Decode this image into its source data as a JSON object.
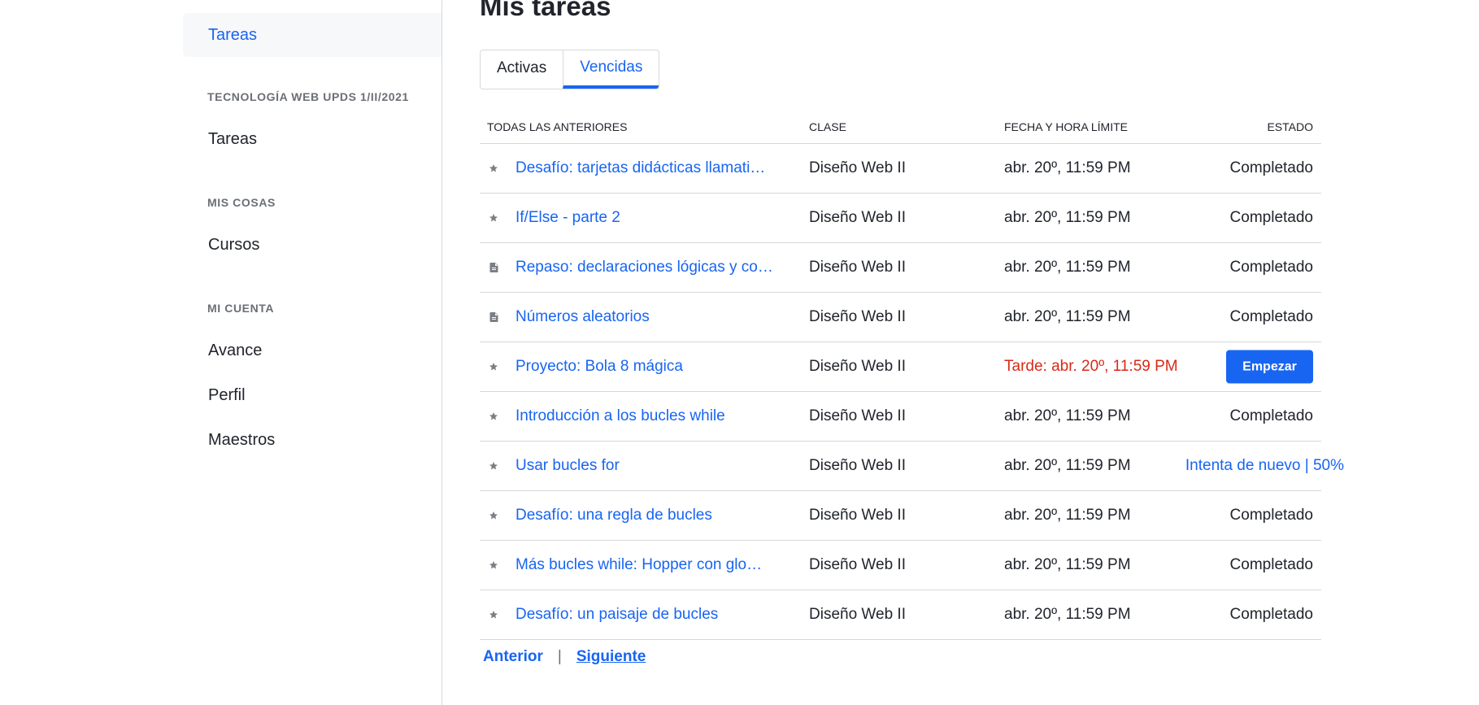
{
  "sidebar": {
    "active_item": "Tareas",
    "sections": [
      {
        "heading": "TECNOLOGÍA WEB UPDS 1/II/2021",
        "items": [
          "Tareas"
        ]
      },
      {
        "heading": "MIS COSAS",
        "items": [
          "Cursos"
        ]
      },
      {
        "heading": "MI CUENTA",
        "items": [
          "Avance",
          "Perfil",
          "Maestros"
        ]
      }
    ]
  },
  "main": {
    "title": "Mis tareas",
    "tabs": [
      {
        "label": "Activas",
        "active": false
      },
      {
        "label": "Vencidas",
        "active": true
      }
    ],
    "columns": [
      "TODAS LAS ANTERIORES",
      "CLASE",
      "FECHA Y HORA LÍMITE",
      "ESTADO"
    ],
    "rows": [
      {
        "icon": "star-icon",
        "title": "Desafío: tarjetas didácticas llamati…",
        "class": "Diseño Web II",
        "due": "abr. 20º, 11:59 PM",
        "late": false,
        "status": "Completado"
      },
      {
        "icon": "star-icon",
        "title": "If/Else - parte 2",
        "class": "Diseño Web II",
        "due": "abr. 20º, 11:59 PM",
        "late": false,
        "status": "Completado"
      },
      {
        "icon": "document-icon",
        "title": "Repaso: declaraciones lógicas y co…",
        "class": "Diseño Web II",
        "due": "abr. 20º, 11:59 PM",
        "late": false,
        "status": "Completado"
      },
      {
        "icon": "document-icon",
        "title": "Números aleatorios",
        "class": "Diseño Web II",
        "due": "abr. 20º, 11:59 PM",
        "late": false,
        "status": "Completado"
      },
      {
        "icon": "star-icon",
        "title": "Proyecto: Bola 8 mágica",
        "class": "Diseño Web II",
        "due": "Tarde: abr. 20º, 11:59 PM",
        "late": true,
        "action": "Empezar"
      },
      {
        "icon": "star-icon",
        "title": "Introducción a los bucles while",
        "class": "Diseño Web II",
        "due": "abr. 20º, 11:59 PM",
        "late": false,
        "status": "Completado"
      },
      {
        "icon": "star-icon",
        "title": "Usar bucles for",
        "class": "Diseño Web II",
        "due": "abr. 20º, 11:59 PM",
        "late": false,
        "retry": "Intenta de nuevo",
        "score": "50%"
      },
      {
        "icon": "star-icon",
        "title": "Desafío: una regla de bucles",
        "class": "Diseño Web II",
        "due": "abr. 20º, 11:59 PM",
        "late": false,
        "status": "Completado"
      },
      {
        "icon": "star-icon",
        "title": "Más bucles while: Hopper con glo…",
        "class": "Diseño Web II",
        "due": "abr. 20º, 11:59 PM",
        "late": false,
        "status": "Completado"
      },
      {
        "icon": "star-icon",
        "title": "Desafío: un paisaje de bucles",
        "class": "Diseño Web II",
        "due": "abr. 20º, 11:59 PM",
        "late": false,
        "status": "Completado"
      }
    ],
    "pagination": {
      "prev": "Anterior",
      "separator": "|",
      "next": "Siguiente"
    }
  },
  "colors": {
    "accent": "#1865f2",
    "late": "#d92916",
    "text": "#21242c",
    "muted": "#6b6f76"
  }
}
